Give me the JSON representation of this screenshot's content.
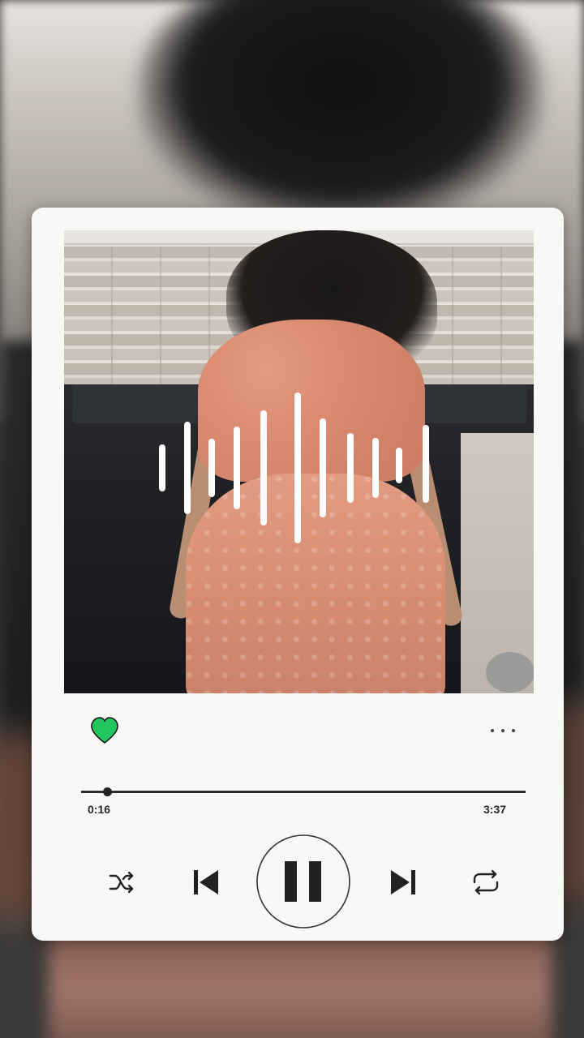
{
  "player": {
    "elapsed": "0:16",
    "duration": "3:37",
    "progress_fraction": 0.058,
    "liked": true,
    "is_playing": true
  },
  "icons": {
    "like": "heart-icon",
    "more": "more-options-icon",
    "shuffle": "shuffle-icon",
    "previous": "skip-previous-icon",
    "play_pause": "pause-icon",
    "next": "skip-next-icon",
    "repeat": "repeat-icon"
  },
  "colors": {
    "heart": "#22c55e",
    "card": "#f8f8f6",
    "icon": "#222222"
  }
}
